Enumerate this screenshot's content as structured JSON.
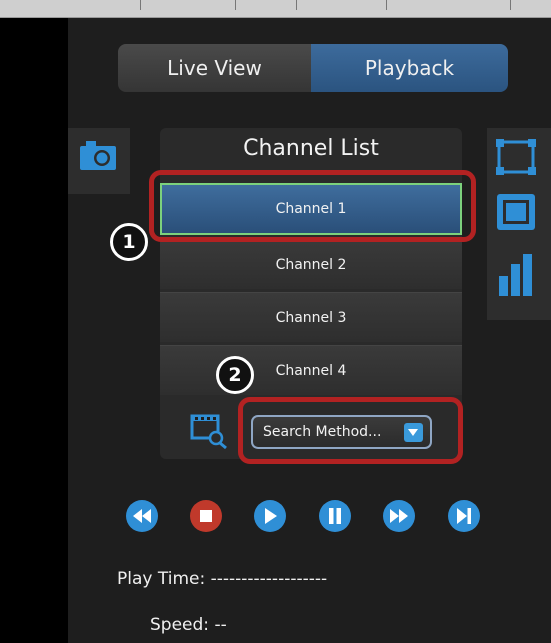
{
  "tabs": {
    "live_view": "Live View",
    "playback": "Playback"
  },
  "channel_list": {
    "title": "Channel List",
    "channels": [
      "Channel 1",
      "Channel 2",
      "Channel 3",
      "Channel 4"
    ],
    "selected_index": 0
  },
  "search": {
    "selected_value": "Search Method..."
  },
  "annotations": {
    "badge_1": "1",
    "badge_2": "2"
  },
  "playback_controls": [
    "rewind-icon",
    "stop-icon",
    "play-icon",
    "pause-icon",
    "fast-forward-icon",
    "next-frame-icon"
  ],
  "status": {
    "play_time_label": "Play Time:",
    "play_time_value": "-------------------",
    "speed_label": "Speed:",
    "speed_value": "--"
  },
  "colors": {
    "accent_blue": "#2f8fd6",
    "stop_red": "#c0392b",
    "callout_red": "#b22222",
    "selected_border": "#7cd17c"
  }
}
